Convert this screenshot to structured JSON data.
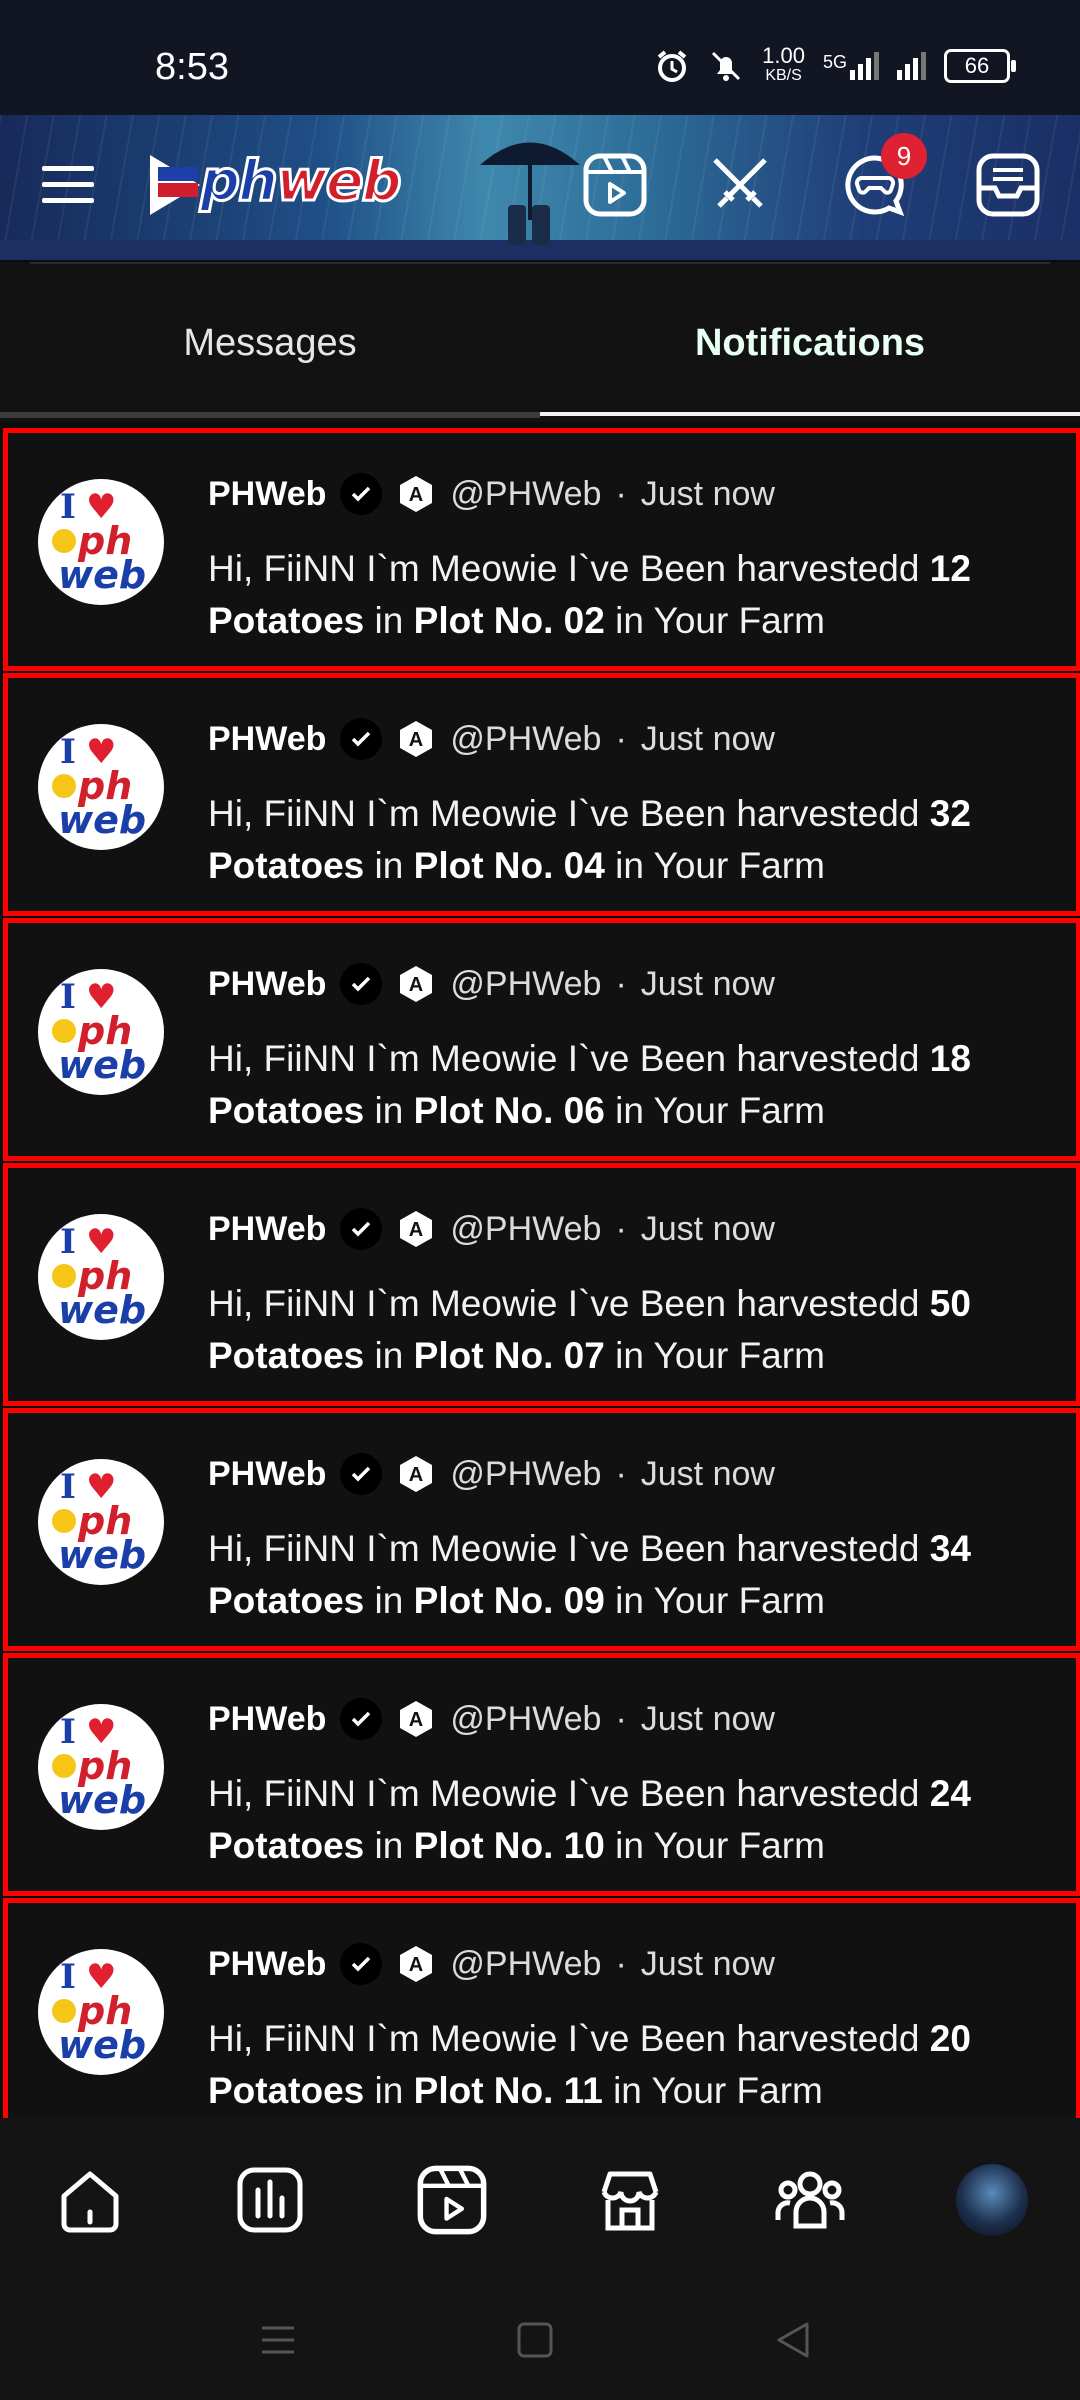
{
  "status_bar": {
    "time": "8:53",
    "net_speed": "1.00",
    "net_unit": "KB/S",
    "network": "5G",
    "battery": "66"
  },
  "header": {
    "logo_text_ph": "ph",
    "logo_text_web": "web",
    "chat_badge": "9"
  },
  "tabs": [
    {
      "label": "Messages",
      "active": false
    },
    {
      "label": "Notifications",
      "active": true
    }
  ],
  "notifications": [
    {
      "name": "PHWeb",
      "handle": "@PHWeb",
      "separator": "·",
      "time": "Just now",
      "text_prefix": "Hi, FiiNN I`m Meowie I`ve Been harvestedd",
      "qty": "12",
      "item": "Potatoes",
      "in1": "in",
      "plot": "Plot No. 02",
      "suffix": "in Your Farm"
    },
    {
      "name": "PHWeb",
      "handle": "@PHWeb",
      "separator": "·",
      "time": "Just now",
      "text_prefix": "Hi, FiiNN I`m Meowie I`ve Been harvestedd",
      "qty": "32",
      "item": "Potatoes",
      "in1": "in",
      "plot": "Plot No. 04",
      "suffix": "in Your Farm"
    },
    {
      "name": "PHWeb",
      "handle": "@PHWeb",
      "separator": "·",
      "time": "Just now",
      "text_prefix": "Hi, FiiNN I`m Meowie I`ve Been harvestedd",
      "qty": "18",
      "item": "Potatoes",
      "in1": "in",
      "plot": "Plot No. 06",
      "suffix": "in Your Farm"
    },
    {
      "name": "PHWeb",
      "handle": "@PHWeb",
      "separator": "·",
      "time": "Just now",
      "text_prefix": "Hi, FiiNN I`m Meowie I`ve Been harvestedd",
      "qty": "50",
      "item": "Potatoes",
      "in1": "in",
      "plot": "Plot No. 07",
      "suffix": "in Your Farm"
    },
    {
      "name": "PHWeb",
      "handle": "@PHWeb",
      "separator": "·",
      "time": "Just now",
      "text_prefix": "Hi, FiiNN I`m Meowie I`ve Been harvestedd",
      "qty": "34",
      "item": "Potatoes",
      "in1": "in",
      "plot": "Plot No. 09",
      "suffix": "in Your Farm"
    },
    {
      "name": "PHWeb",
      "handle": "@PHWeb",
      "separator": "·",
      "time": "Just now",
      "text_prefix": "Hi, FiiNN I`m Meowie I`ve Been harvestedd",
      "qty": "24",
      "item": "Potatoes",
      "in1": "in",
      "plot": "Plot No. 10",
      "suffix": "in Your Farm"
    },
    {
      "name": "PHWeb",
      "handle": "@PHWeb",
      "separator": "·",
      "time": "Just now",
      "text_prefix": "Hi, FiiNN I`m Meowie I`ve Been harvestedd",
      "qty": "20",
      "item": "Potatoes",
      "in1": "in",
      "plot": "Plot No. 11",
      "suffix": "in Your Farm"
    }
  ],
  "bottom_nav": [
    {
      "icon": "home-icon"
    },
    {
      "icon": "stats-icon"
    },
    {
      "icon": "reels-icon"
    },
    {
      "icon": "store-icon"
    },
    {
      "icon": "groups-icon"
    },
    {
      "icon": "profile-avatar"
    }
  ],
  "colors": {
    "notification_border": "#ff0000",
    "badge": "#e02131",
    "background": "#0d0d0d"
  }
}
